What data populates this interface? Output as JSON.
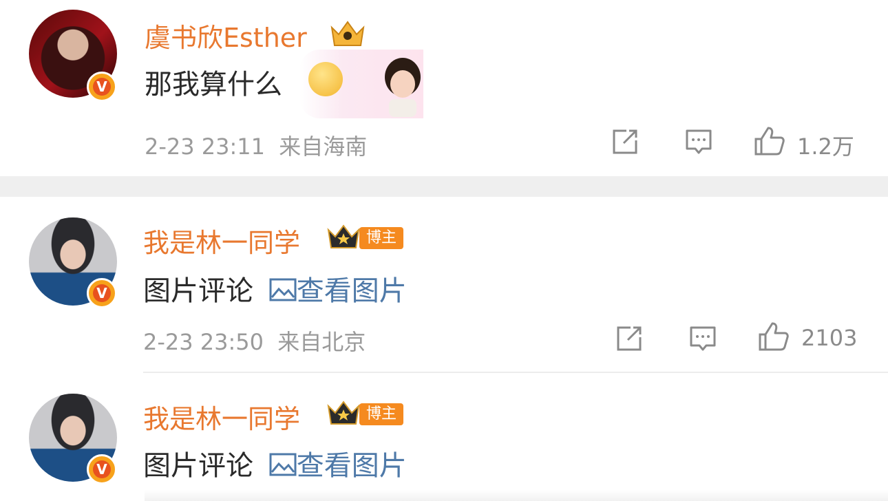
{
  "comments": [
    {
      "username": "虞书欣Esther",
      "text": "那我算什么",
      "time": "2-23 23:11",
      "location": "来自海南",
      "likes": "1.2万"
    },
    {
      "username": "我是林一同学",
      "tag": "博主",
      "text": "图片评论",
      "link": "查看图片",
      "time": "2-23 23:50",
      "location": "来自北京",
      "likes": "2103"
    },
    {
      "username": "我是林一同学",
      "tag": "博主",
      "text": "图片评论",
      "link": "查看图片"
    }
  ],
  "verified_mark": "V",
  "colors": {
    "username": "#e8782f",
    "link": "#4e79a8",
    "meta": "#9a9a9a",
    "tag_bg": "#f58a1f",
    "verified": "#e8521e"
  },
  "icons": [
    "share-icon",
    "comment-icon",
    "like-icon",
    "crown-icon",
    "image-icon",
    "emoji-icon"
  ]
}
